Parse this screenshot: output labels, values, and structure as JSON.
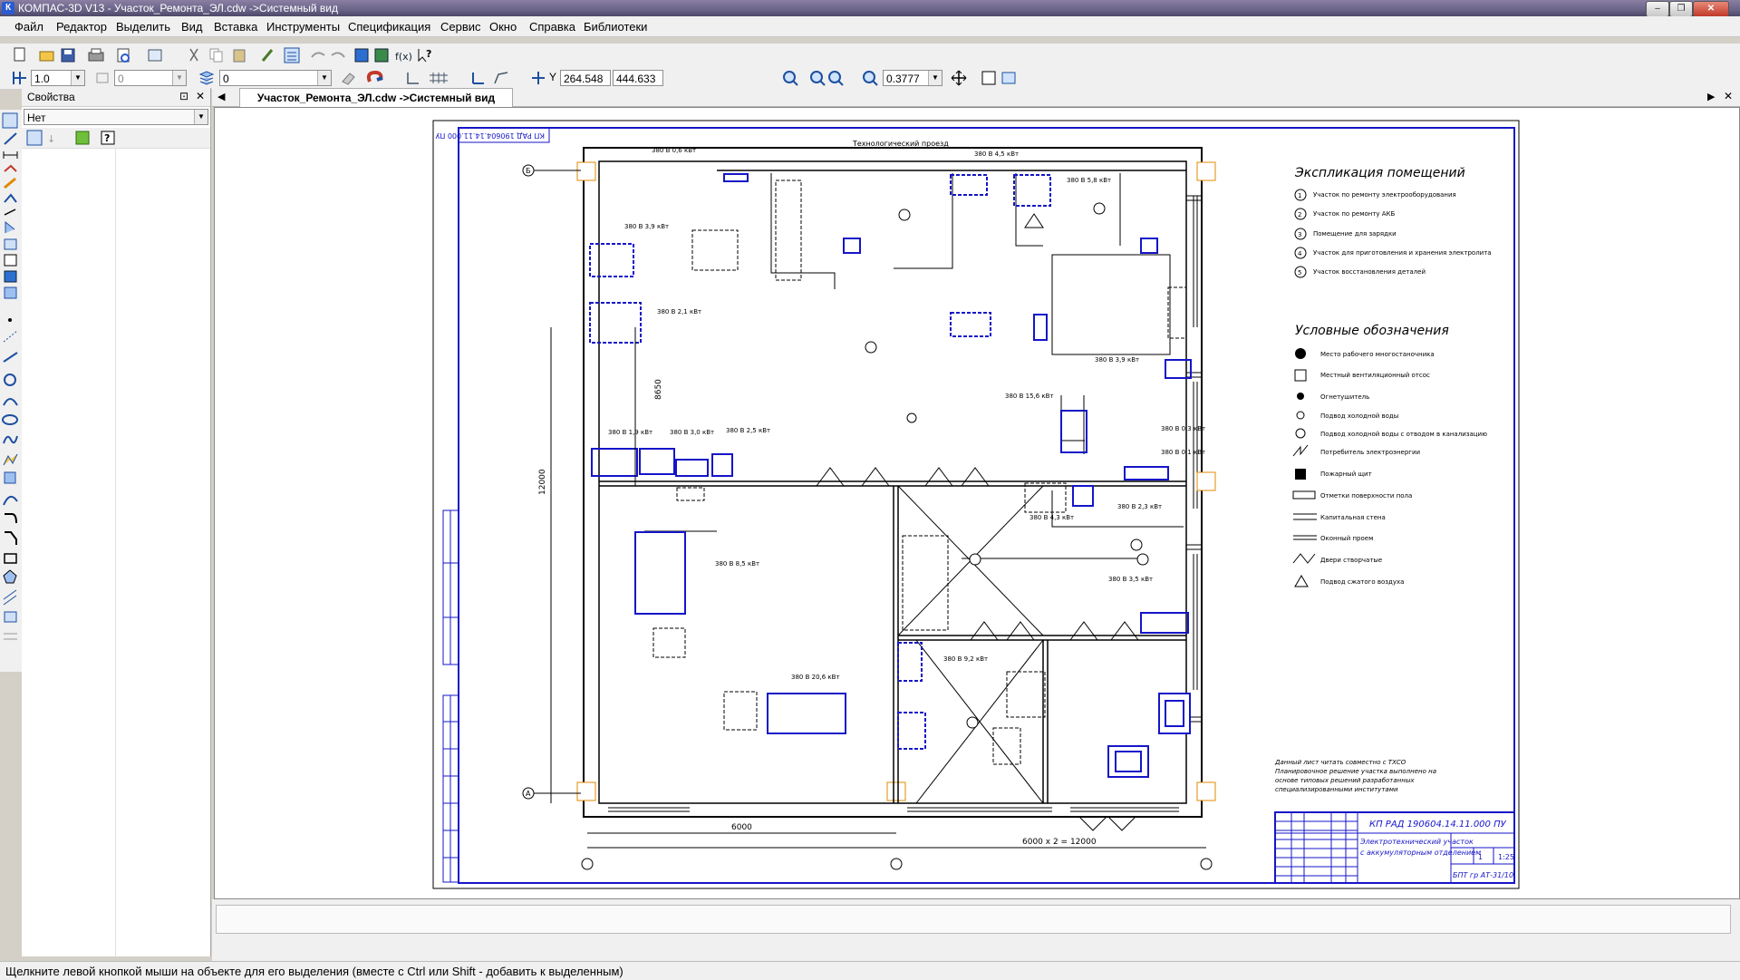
{
  "window": {
    "title": "КОМПАС-3D V13 - Участок_Ремонта_ЭЛ.cdw ->Системный вид",
    "app_icon": "К",
    "buttons": {
      "minimize": "–",
      "maximize": "❐",
      "close": "✕"
    }
  },
  "menu": [
    "Файл",
    "Редактор",
    "Выделить",
    "Вид",
    "Вставка",
    "Инструменты",
    "Спецификация",
    "Сервис",
    "Окно",
    "Справка",
    "Библиотеки"
  ],
  "toolbar2": {
    "scale_value": "1.0",
    "step_value": "0",
    "layer_value": "0",
    "coord_label": "Y",
    "coord_x": "264.548",
    "coord_y": "444.633",
    "zoom_value": "0.3777"
  },
  "properties": {
    "title": "Свойства",
    "pin": "⊡",
    "close": "✕",
    "select_value": "Нет"
  },
  "doc": {
    "tab_label": "Участок_Ремонта_ЭЛ.cdw ->Системный вид",
    "nav_left": "◀",
    "nav_right": "▶",
    "close": "✕"
  },
  "drawing": {
    "stamp_rotated": "КП РАД 190604.14.11.000 ПУ",
    "top_passage": "Технологический проезд",
    "explication_title": "Экспликация помещений",
    "explication": [
      {
        "num": "1",
        "text": "Участок по ремонту электрооборудования"
      },
      {
        "num": "2",
        "text": "Участок по ремонту АКБ"
      },
      {
        "num": "3",
        "text": "Помещение для зарядки"
      },
      {
        "num": "4",
        "text": "Участок для приготовления и хранения электролита"
      },
      {
        "num": "5",
        "text": "Участок восстановления деталей"
      }
    ],
    "legend_title": "Условные обозначения",
    "legend": [
      "Место рабочего многостаночника",
      "Местный вентиляционный отсос",
      "Огнетушитель",
      "Подвод холодной воды",
      "Подвод холодной воды с отводом в канализацию",
      "Потребитель электроэнергии",
      "Пожарный щит",
      "Отметки поверхности пола",
      "Капитальная стена",
      "Оконный проем",
      "Двери створчатые",
      "Подвод сжатого воздуха"
    ],
    "note": [
      "Данный лист читать совместно с ТХСО",
      "Планировочное решение участка выполнено на",
      "основе типовых решений разработанных",
      "специализированными институтами"
    ],
    "titleblock": {
      "code": "КП РАД 190604.14.11.000 ПУ",
      "name1": "Электротехнический участок",
      "name2": "с аккумуляторным отделением",
      "sheet": "1",
      "sheets": "1",
      "scale": "1:25",
      "org": "БПТ гр АТ-31/10"
    },
    "dims": {
      "bottom_left": "6000",
      "bottom_total": "6000 x 2 = 12000",
      "left_total": "12000",
      "left_mid": "8650"
    },
    "axis_a": "А",
    "axis_b": "Б",
    "labels": [
      "380 В 0,6 кВт",
      "380 В 4,5 кВт",
      "380 В 5,8 кВт",
      "380 В 3,9 кВт",
      "380 В 2,1 кВт",
      "380 В 3,9 кВт",
      "380 В 15,6 кВт",
      "380 В 1,9 кВт",
      "380 В 3,0 кВт",
      "380 В 2,5 кВт",
      "380 В 0,3 кВт",
      "380 В 0,1 кВт",
      "380 В 8,5 кВт",
      "380 В 2,3 кВт",
      "380 В 4,3 кВт",
      "380 В 3,5 кВт",
      "380 В 9,2 кВт",
      "380 В 20,6 кВт"
    ]
  },
  "status": "Щелкните левой кнопкой мыши на объекте для его выделения (вместе с Ctrl или Shift - добавить к выделенным)"
}
